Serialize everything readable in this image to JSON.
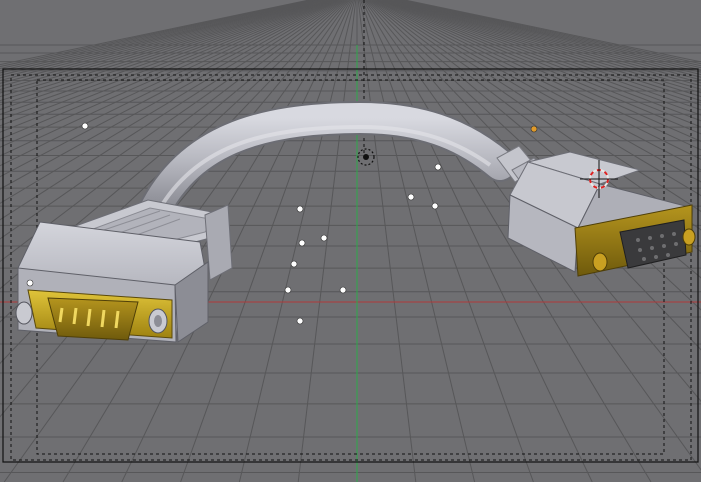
{
  "viewport": {
    "background": "#6f6f72",
    "grid_color": "#575759",
    "x_axis_color": "#b03a3a",
    "z_axis_color": "#2ea84a",
    "frame_color": "#111111",
    "lamp_color": "#ffffff",
    "active_lamp_color": "#e09a2a"
  },
  "scene": {
    "objects": [
      {
        "name": "dsub-male-connector",
        "metal_color": "#c2a21b",
        "housing_color": "#b9bac2"
      },
      {
        "name": "vga-cable",
        "color": "#a9aab3"
      },
      {
        "name": "dsub-female-connector",
        "metal_color": "#9c7c18",
        "housing_color": "#b9bac2"
      }
    ],
    "icons": [
      "camera-icon",
      "3d-cursor-icon",
      "lamp-icon"
    ]
  }
}
